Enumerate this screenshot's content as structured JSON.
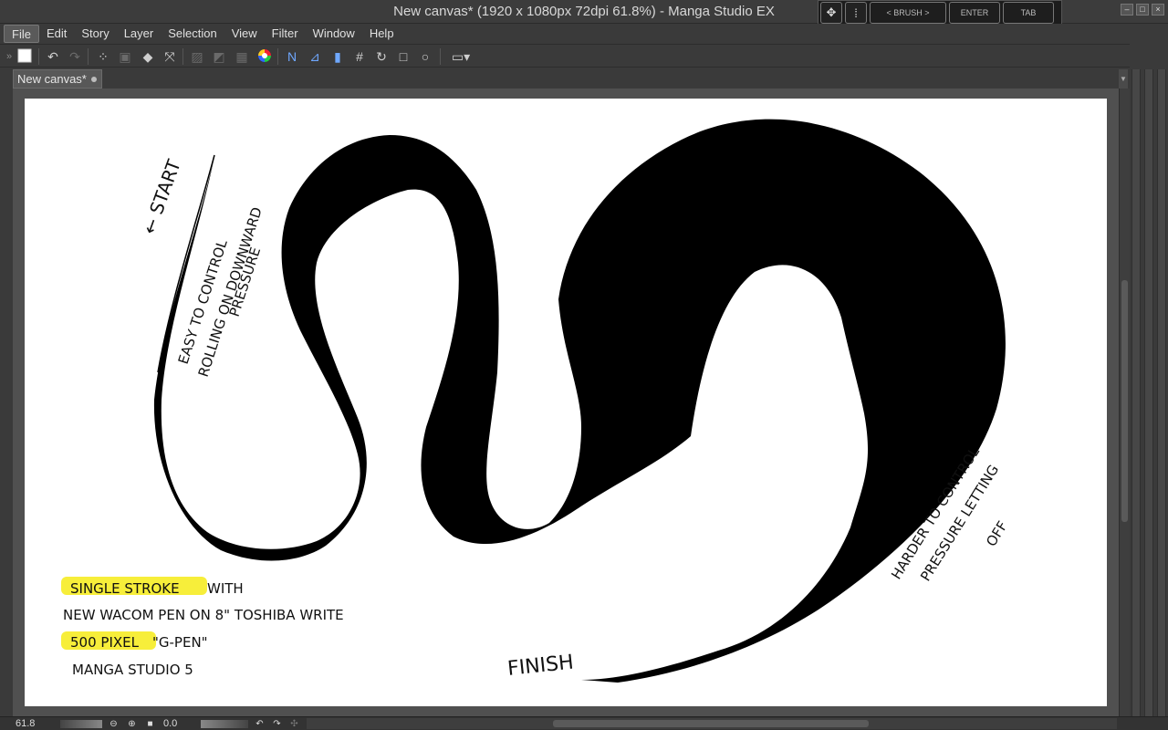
{
  "window": {
    "title": "New canvas* (1920 x 1080px 72dpi 61.8%)  - Manga Studio EX"
  },
  "float_panel": {
    "icons": [
      "move-arrows-icon",
      "grid-dots-icon"
    ],
    "buttons": [
      "< BRUSH >",
      "ENTER",
      "TAB"
    ]
  },
  "menu": {
    "items": [
      "File",
      "Edit",
      "Story",
      "Layer",
      "Selection",
      "View",
      "Filter",
      "Window",
      "Help"
    ],
    "active": "File"
  },
  "tabs": [
    {
      "label": "New canvas*"
    }
  ],
  "canvas": {
    "annotations": {
      "start": "← START",
      "easy_line1": "EASY TO CONTROL",
      "easy_line2": "ROLLING ON DOWNWARD",
      "easy_line3": "PRESSURE",
      "harder_line1": "HARDER TO CONTROL",
      "harder_line2": "PRESSURE LETTING",
      "harder_line3": "OFF",
      "finish": "FINISH",
      "note_line1_hl": "SINGLE STROKE",
      "note_line1_rest": " WITH",
      "note_line2": "NEW WACOM PEN ON 8\" TOSHIBA WRITE",
      "note_line3_hl": "500 PIXEL",
      "note_line3_rest": " \"G-PEN\"",
      "note_line4": "MANGA STUDIO 5"
    },
    "highlight_color": "#f7ee3a",
    "stroke_color": "#000000"
  },
  "status": {
    "zoom": "61.8",
    "rotation": "0.0"
  }
}
